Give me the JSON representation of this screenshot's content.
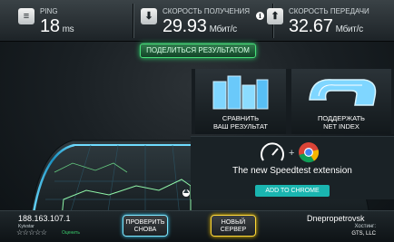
{
  "header": {
    "ping": {
      "label": "PING",
      "value": "18",
      "unit": "ms"
    },
    "download": {
      "label": "СКОРОСТЬ ПОЛУЧЕНИЯ",
      "value": "29.93",
      "unit": "Мбит/с"
    },
    "upload": {
      "label": "СКОРОСТЬ ПЕРЕДАЧИ",
      "value": "32.67",
      "unit": "Мбит/с"
    }
  },
  "share_button": "ПОДЕЛИТЬСЯ РЕЗУЛЬТАТОМ",
  "tiles": {
    "compare": {
      "line1": "СРАВНИТЬ",
      "line2": "ВАШ РЕЗУЛЬТАТ"
    },
    "support": {
      "line1": "ПОДДЕРЖАТЬ",
      "line2": "NET INDEX"
    }
  },
  "extension": {
    "title": "The new Speedtest extension",
    "button": "ADD TO CHROME"
  },
  "bottom": {
    "ip": "188.163.107.1",
    "isp": "Kyivstar",
    "rate_label": "Оценить",
    "stars": "☆☆☆☆☆",
    "retest": {
      "line1": "ПРОВЕРИТЬ",
      "line2": "СНОВА"
    },
    "newserver": {
      "line1": "НОВЫЙ",
      "line2": "СЕРВЕР"
    },
    "city": "Dnepropetrovsk",
    "host_label": "Хостинг:",
    "host_value": "GTS, LLC"
  },
  "colors": {
    "accent_green": "#48e07a",
    "accent_cyan": "#1ab5b0",
    "accent_yellow": "#ffd93a"
  }
}
